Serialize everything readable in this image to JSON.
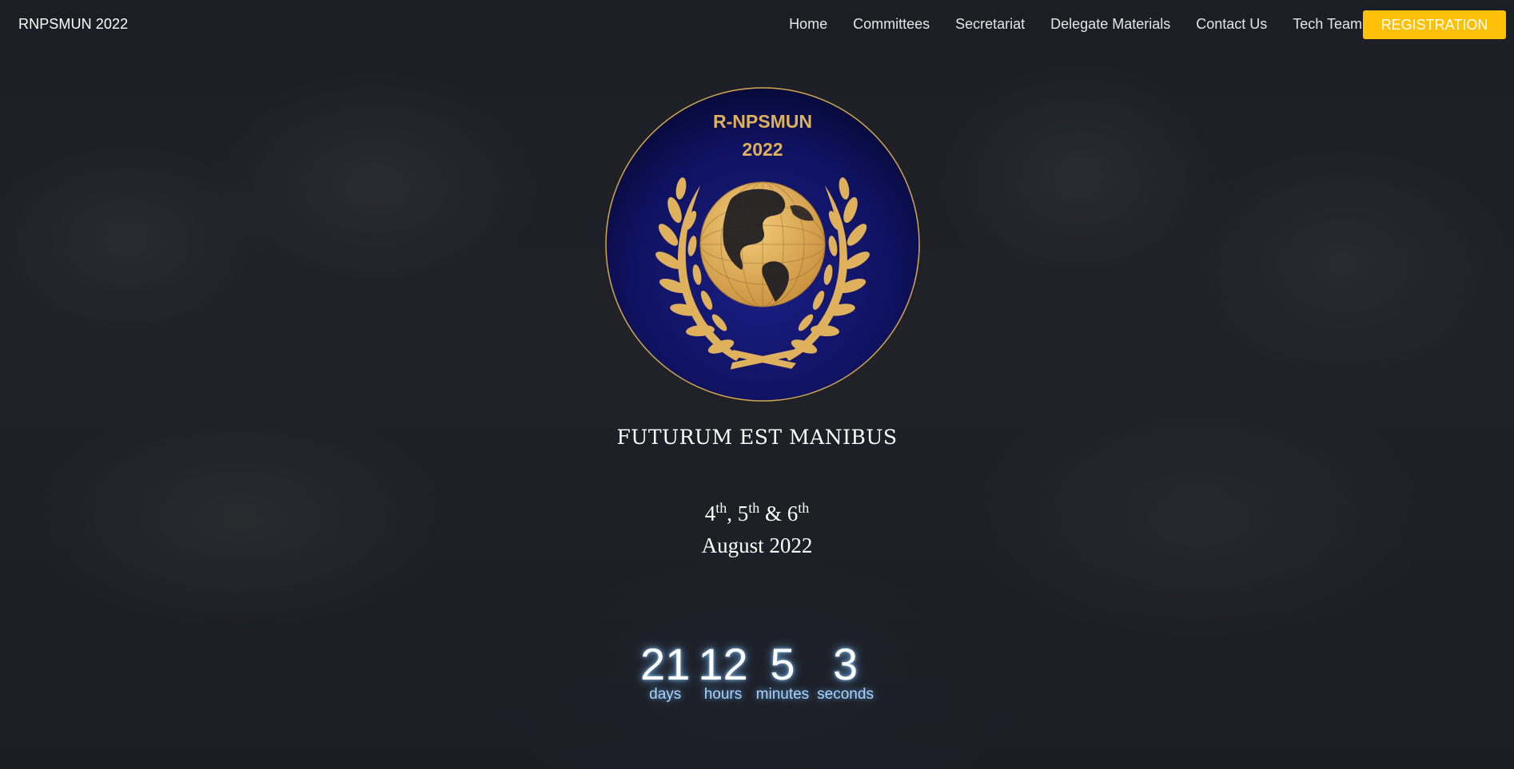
{
  "nav": {
    "brand": "RNPSMUN 2022",
    "links": [
      "Home",
      "Committees",
      "Secretariat",
      "Delegate Materials",
      "Contact Us",
      "Tech Team"
    ],
    "register_label": "REGISTRATION",
    "register_color": "#ffc107"
  },
  "logo": {
    "line1": "R-NPSMUN",
    "line2": "2022",
    "emblem_icon": "globe-laurel-icon",
    "gold": "#e0b15c",
    "navy": "#10135e"
  },
  "hero": {
    "motto": "FUTURUM EST MANIBUS",
    "dates": {
      "d1": "4",
      "d2": "5",
      "d3": "6",
      "suffix": "th",
      "sep1": ", ",
      "sep2": " & ",
      "month_year": "August 2022"
    }
  },
  "countdown": [
    {
      "value": "21",
      "label": "days"
    },
    {
      "value": "12",
      "label": "hours"
    },
    {
      "value": "5",
      "label": "minutes"
    },
    {
      "value": "3",
      "label": "seconds"
    }
  ]
}
